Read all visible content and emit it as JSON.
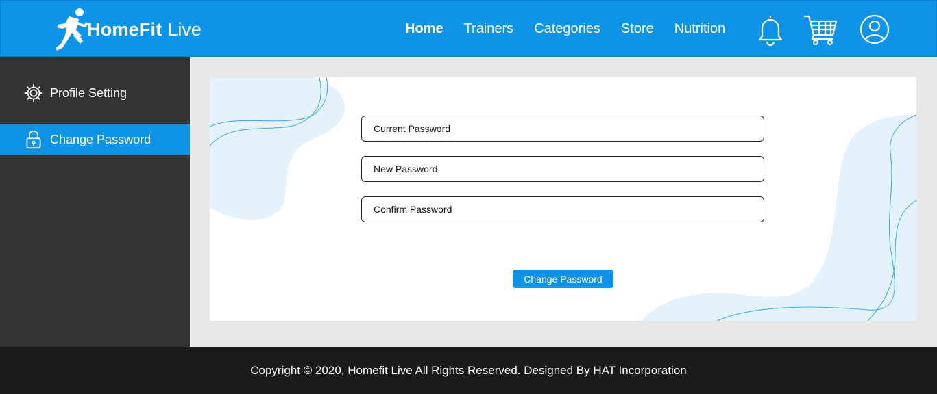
{
  "header": {
    "brand_name": "HomeFit",
    "brand_suffix": "Live",
    "logo_icon": "runner-icon",
    "nav": [
      {
        "label": "Home",
        "active": true
      },
      {
        "label": "Trainers",
        "active": false
      },
      {
        "label": "Categories",
        "active": false
      },
      {
        "label": "Store",
        "active": false
      },
      {
        "label": "Nutrition",
        "active": false
      }
    ],
    "icons": [
      "bell-icon",
      "cart-icon",
      "user-icon"
    ]
  },
  "sidebar": {
    "items": [
      {
        "label": "Profile Setting",
        "icon": "gear-icon",
        "active": false
      },
      {
        "label": "Change Password",
        "icon": "lock-icon",
        "active": true
      }
    ]
  },
  "form": {
    "current_password_placeholder": "Current Password",
    "new_password_placeholder": "New Password",
    "confirm_password_placeholder": "Confirm Password",
    "submit_label": "Change Password"
  },
  "footer": {
    "copyright": "Copyright © 2020, Homefit Live All Rights Reserved. Designed By HAT Incorporation"
  },
  "colors": {
    "primary": "#0f93e7",
    "sidebar": "#333333",
    "footer": "#1b1b1b",
    "page_bg": "#e8e8e8",
    "decor_blob": "#e3f2fc"
  }
}
